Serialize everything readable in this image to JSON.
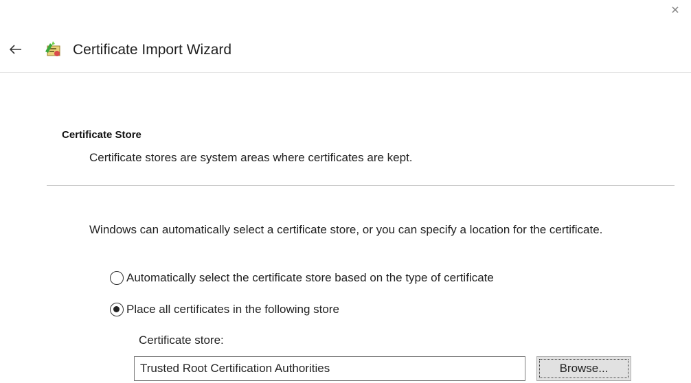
{
  "window": {
    "title": "Certificate Import Wizard",
    "close_icon": "close-icon"
  },
  "titlebar": {
    "back_icon": "back-arrow-icon",
    "wizard_icon": "certificate-wizard-icon"
  },
  "section": {
    "heading": "Certificate Store",
    "description": "Certificate stores are system areas where certificates are kept."
  },
  "body": {
    "intro": "Windows can automatically select a certificate store, or you can specify a location for the certificate."
  },
  "options": [
    {
      "label": "Automatically select the certificate store based on the type of certificate",
      "selected": false
    },
    {
      "label": "Place all certificates in the following store",
      "selected": true
    }
  ],
  "store": {
    "label": "Certificate store:",
    "value": "Trusted Root Certification Authorities",
    "browse_label": "Browse..."
  },
  "colors": {
    "background": "#ffffff",
    "text": "#222222",
    "divider": "#bdbdbd",
    "button_face": "#e1e1e1"
  }
}
